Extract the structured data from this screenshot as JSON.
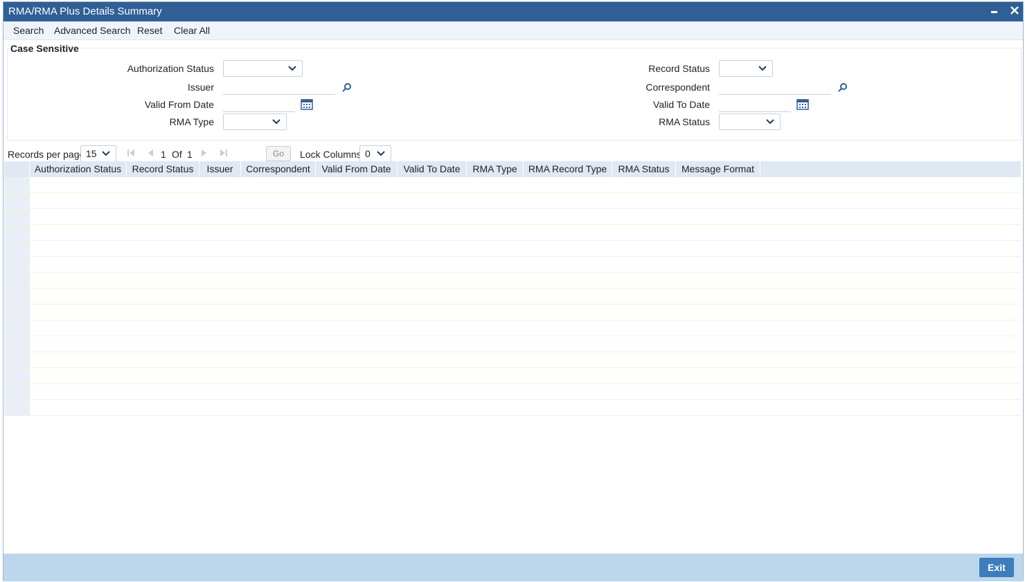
{
  "window": {
    "title": "RMA/RMA Plus Details Summary",
    "minimize_icon": "minimize-icon",
    "close_icon": "close-icon"
  },
  "menu": {
    "search": "Search",
    "advanced_search": "Advanced Search",
    "reset": "Reset",
    "clear_all": "Clear All"
  },
  "criteria": {
    "legend": "Case Sensitive",
    "authorization_status": {
      "label": "Authorization Status",
      "value": ""
    },
    "issuer": {
      "label": "Issuer",
      "value": ""
    },
    "valid_from_date": {
      "label": "Valid From Date",
      "value": ""
    },
    "rma_type": {
      "label": "RMA Type",
      "value": ""
    },
    "record_status": {
      "label": "Record Status",
      "value": ""
    },
    "correspondent": {
      "label": "Correspondent",
      "value": ""
    },
    "valid_to_date": {
      "label": "Valid To Date",
      "value": ""
    },
    "rma_status": {
      "label": "RMA Status",
      "value": ""
    }
  },
  "pager": {
    "records_per_page_label": "Records per page",
    "records_per_page": "15",
    "current_page": "1",
    "of_label": "Of",
    "total_pages": "1",
    "go_label": "Go",
    "lock_columns_label": "Lock Columns",
    "lock_columns": "0"
  },
  "grid": {
    "columns": [
      "Authorization Status",
      "Record Status",
      "Issuer",
      "Correspondent",
      "Valid From Date",
      "Valid To Date",
      "RMA Type",
      "RMA Record Type",
      "RMA Status",
      "Message Format"
    ],
    "row_count": 15
  },
  "footer": {
    "exit_label": "Exit"
  },
  "colors": {
    "titlebar": "#2f5f95",
    "accent": "#3d7dbd",
    "footer": "#bcd6eb",
    "grid_header": "#dfe8f3"
  }
}
